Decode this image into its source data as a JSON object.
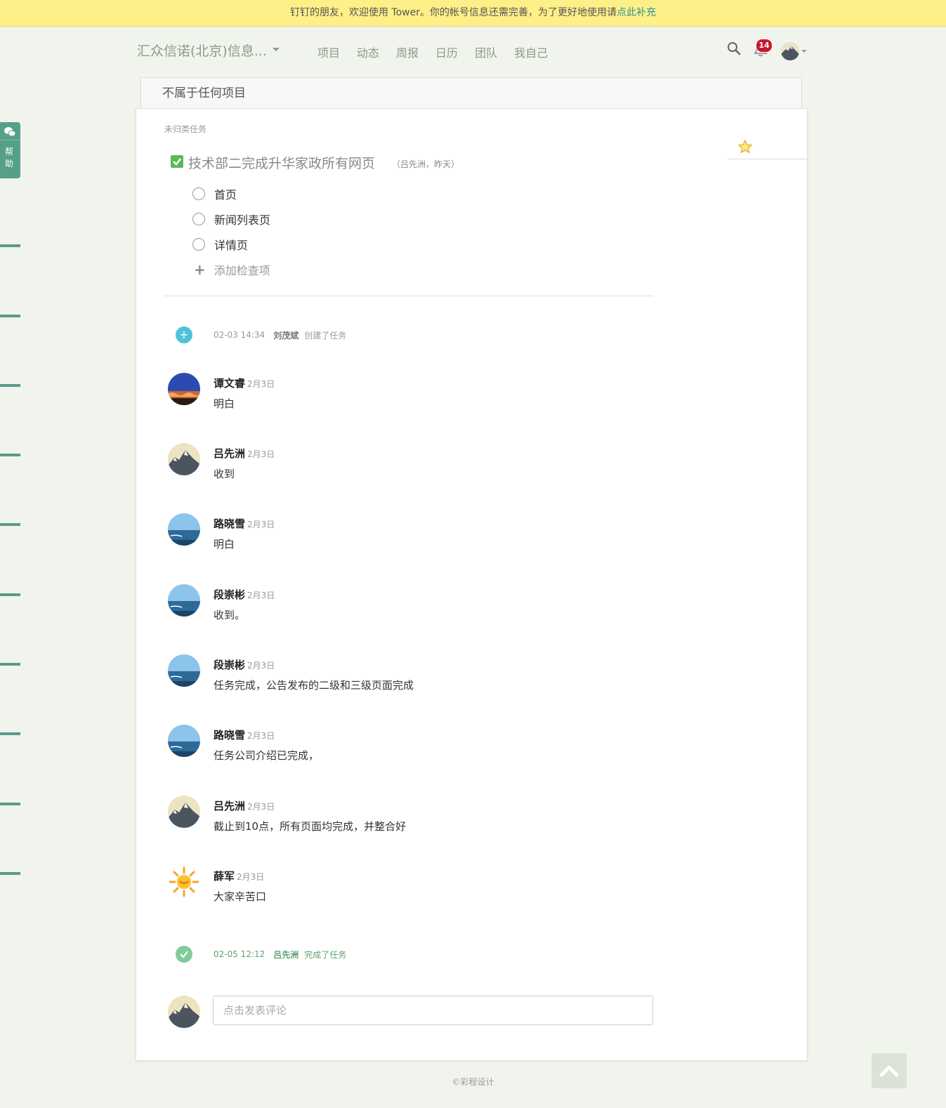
{
  "notice": {
    "text": "钉钉的朋友，欢迎使用 Tower。你的帐号信息还需完善，为了更好地使用请",
    "link": "点此补充"
  },
  "header": {
    "team_name": "汇众信诺(北京)信息...",
    "nav": [
      "项目",
      "动态",
      "周报",
      "日历",
      "团队",
      "我自己"
    ],
    "notification_count": "14",
    "icons": [
      "search-icon",
      "bell-icon",
      "avatar"
    ]
  },
  "project": {
    "title": "不属于任何项目"
  },
  "task": {
    "category": "未归类任务",
    "title": "技术部二完成升华家政所有网页",
    "meta": "（吕先洲，昨天）",
    "checklist": [
      "首页",
      "新闻列表页",
      "详情页"
    ],
    "add_check_label": "添加检查项"
  },
  "events": {
    "created": {
      "time": "02-03 14:34",
      "who": "刘茂斌",
      "action": "创建了任务"
    },
    "completed": {
      "time": "02-05 12:12",
      "who": "吕先洲",
      "action": "完成了任务"
    }
  },
  "comments": [
    {
      "name": "谭文睿",
      "date": "2月3日",
      "text": "明白",
      "avatar": "sunset"
    },
    {
      "name": "吕先洲",
      "date": "2月3日",
      "text": "收到",
      "avatar": "mountain"
    },
    {
      "name": "路晓雪",
      "date": "2月3日",
      "text": "明白",
      "avatar": "sea"
    },
    {
      "name": "段崇彬",
      "date": "2月3日",
      "text": "收到。",
      "avatar": "sea"
    },
    {
      "name": "段崇彬",
      "date": "2月3日",
      "text": "任务完成，公告发布的二级和三级页面完成",
      "avatar": "sea"
    },
    {
      "name": "路晓雪",
      "date": "2月3日",
      "text": "任务公司介绍已完成，",
      "avatar": "sea"
    },
    {
      "name": "吕先洲",
      "date": "2月3日",
      "text": "截止到10点，所有页面均完成，并整合好",
      "avatar": "mountain"
    },
    {
      "name": "薛军",
      "date": "2月3日",
      "text": "大家辛苦口",
      "avatar": "sun"
    }
  ],
  "comment_box": {
    "placeholder": "点击发表评论",
    "value": ""
  },
  "help_tab": {
    "label": "帮助"
  },
  "footer": {
    "text": "©彩程设计"
  },
  "colors": {
    "accent_green": "#5cb85c",
    "notice_bg": "#fef088",
    "badge": "#c8182d",
    "page_bg": "#f1f4ec",
    "help_tab": "#56a08a"
  }
}
